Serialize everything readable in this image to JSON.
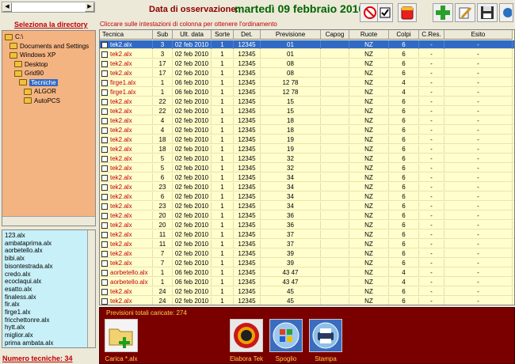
{
  "header": {
    "date_label": "Data di osservazione:",
    "date_value": "martedì 09 febbraio 2010"
  },
  "toolbar": [
    {
      "icon": "no-sign-icon"
    },
    {
      "icon": "checkmark-icon"
    },
    {
      "icon": "paint-bucket-icon"
    },
    {
      "icon": "green-plus-icon"
    },
    {
      "icon": "pencil-edit-icon"
    },
    {
      "icon": "save-disk-icon"
    },
    {
      "icon": "tool-icon"
    }
  ],
  "sidebar": {
    "directory_title": "Seleziona la directory",
    "tree": [
      {
        "label": "C:\\",
        "level": 0,
        "selected": false
      },
      {
        "label": "Documents and Settings",
        "level": 1,
        "selected": false
      },
      {
        "label": "Windows XP",
        "level": 1,
        "selected": false
      },
      {
        "label": "Desktop",
        "level": 2,
        "selected": false
      },
      {
        "label": "Grid90",
        "level": 2,
        "selected": false
      },
      {
        "label": "Tecniche",
        "level": 3,
        "selected": true
      },
      {
        "label": "ALGOR",
        "level": 4,
        "selected": false
      },
      {
        "label": "AutoPCS",
        "level": 4,
        "selected": false
      }
    ],
    "files": [
      "123.alx",
      "ambataprima.alx",
      "aorbetello.alx",
      "bibi.alx",
      "bisontestrada.alx",
      "credo.alx",
      "ecoclaqui.alx",
      "esatto.alx",
      "finaless.alx",
      "fir.alx",
      "firge1.alx",
      "fricchettonre.alx",
      "hytt.alx",
      "miglior.alx",
      "prima ambata.alx"
    ],
    "num_tecniche": "Numero tecniche: 34"
  },
  "main": {
    "hint": "Cliccare sulle intestazioni di colonna per ottenere l'ordinamento",
    "columns": [
      "Tecnica",
      "Sub",
      "Ult. data",
      "Sorte",
      "Det.",
      "Previsione",
      "Capog",
      "Ruote",
      "Colpi",
      "C.Res.",
      "Esito"
    ],
    "rows": [
      [
        "tek2.alx",
        "3",
        "02 feb 2010",
        "1",
        "12345",
        "01",
        "",
        "NZ",
        "6",
        "-",
        "-"
      ],
      [
        "tek2.alx",
        "3",
        "02 feb 2010",
        "1",
        "12345",
        "01",
        "",
        "NZ",
        "6",
        "-",
        "-"
      ],
      [
        "tek2.alx",
        "17",
        "02 feb 2010",
        "1",
        "12345",
        "08",
        "",
        "NZ",
        "6",
        "-",
        "-"
      ],
      [
        "tek2.alx",
        "17",
        "02 feb 2010",
        "1",
        "12345",
        "08",
        "",
        "NZ",
        "6",
        "-",
        "-"
      ],
      [
        "firge1.alx",
        "1",
        "06 feb 2010",
        "1",
        "12345",
        "12 78",
        "",
        "NZ",
        "4",
        "-",
        "-"
      ],
      [
        "firge1.alx",
        "1",
        "06 feb 2010",
        "1",
        "12345",
        "12 78",
        "",
        "NZ",
        "4",
        "-",
        "-"
      ],
      [
        "tek2.alx",
        "22",
        "02 feb 2010",
        "1",
        "12345",
        "15",
        "",
        "NZ",
        "6",
        "-",
        "-"
      ],
      [
        "tek2.alx",
        "22",
        "02 feb 2010",
        "1",
        "12345",
        "15",
        "",
        "NZ",
        "6",
        "-",
        "-"
      ],
      [
        "tek2.alx",
        "4",
        "02 feb 2010",
        "1",
        "12345",
        "18",
        "",
        "NZ",
        "6",
        "-",
        "-"
      ],
      [
        "tek2.alx",
        "4",
        "02 feb 2010",
        "1",
        "12345",
        "18",
        "",
        "NZ",
        "6",
        "-",
        "-"
      ],
      [
        "tek2.alx",
        "18",
        "02 feb 2010",
        "1",
        "12345",
        "19",
        "",
        "NZ",
        "6",
        "-",
        "-"
      ],
      [
        "tek2.alx",
        "18",
        "02 feb 2010",
        "1",
        "12345",
        "19",
        "",
        "NZ",
        "6",
        "-",
        "-"
      ],
      [
        "tek2.alx",
        "5",
        "02 feb 2010",
        "1",
        "12345",
        "32",
        "",
        "NZ",
        "6",
        "-",
        "-"
      ],
      [
        "tek2.alx",
        "5",
        "02 feb 2010",
        "1",
        "12345",
        "32",
        "",
        "NZ",
        "6",
        "-",
        "-"
      ],
      [
        "tek2.alx",
        "6",
        "02 feb 2010",
        "1",
        "12345",
        "34",
        "",
        "NZ",
        "6",
        "-",
        "-"
      ],
      [
        "tek2.alx",
        "23",
        "02 feb 2010",
        "1",
        "12345",
        "34",
        "",
        "NZ",
        "6",
        "-",
        "-"
      ],
      [
        "tek2.alx",
        "6",
        "02 feb 2010",
        "1",
        "12345",
        "34",
        "",
        "NZ",
        "6",
        "-",
        "-"
      ],
      [
        "tek2.alx",
        "23",
        "02 feb 2010",
        "1",
        "12345",
        "34",
        "",
        "NZ",
        "6",
        "-",
        "-"
      ],
      [
        "tek2.alx",
        "20",
        "02 feb 2010",
        "1",
        "12345",
        "36",
        "",
        "NZ",
        "6",
        "-",
        "-"
      ],
      [
        "tek2.alx",
        "20",
        "02 feb 2010",
        "1",
        "12345",
        "36",
        "",
        "NZ",
        "6",
        "-",
        "-"
      ],
      [
        "tek2.alx",
        "11",
        "02 feb 2010",
        "1",
        "12345",
        "37",
        "",
        "NZ",
        "6",
        "-",
        "-"
      ],
      [
        "tek2.alx",
        "11",
        "02 feb 2010",
        "1",
        "12345",
        "37",
        "",
        "NZ",
        "6",
        "-",
        "-"
      ],
      [
        "tek2.alx",
        "7",
        "02 feb 2010",
        "1",
        "12345",
        "39",
        "",
        "NZ",
        "6",
        "-",
        "-"
      ],
      [
        "tek2.alx",
        "7",
        "02 feb 2010",
        "1",
        "12345",
        "39",
        "",
        "NZ",
        "6",
        "-",
        "-"
      ],
      [
        "aorbetello.alx",
        "1",
        "06 feb 2010",
        "1",
        "12345",
        "43 47",
        "",
        "NZ",
        "4",
        "-",
        "-"
      ],
      [
        "aorbetello.alx",
        "1",
        "06 feb 2010",
        "1",
        "12345",
        "43 47",
        "",
        "NZ",
        "4",
        "-",
        "-"
      ],
      [
        "tek2.alx",
        "24",
        "02 feb 2010",
        "1",
        "12345",
        "45",
        "",
        "NZ",
        "6",
        "-",
        "-"
      ],
      [
        "tek2.alx",
        "24",
        "02 feb 2010",
        "1",
        "12345",
        "45",
        "",
        "NZ",
        "6",
        "-",
        "-"
      ]
    ],
    "selected_row": 0
  },
  "bottom": {
    "prev_totali": "Previsioni totali caricate: 274",
    "buttons": [
      {
        "label": "Carica *.alx",
        "icon": "folder-add-icon"
      },
      {
        "label": "Elabora Tek",
        "icon": "elabora-icon"
      },
      {
        "label": "Spoglio",
        "icon": "windows-logo-icon"
      },
      {
        "label": "Stampa",
        "icon": "printer-icon"
      }
    ]
  }
}
